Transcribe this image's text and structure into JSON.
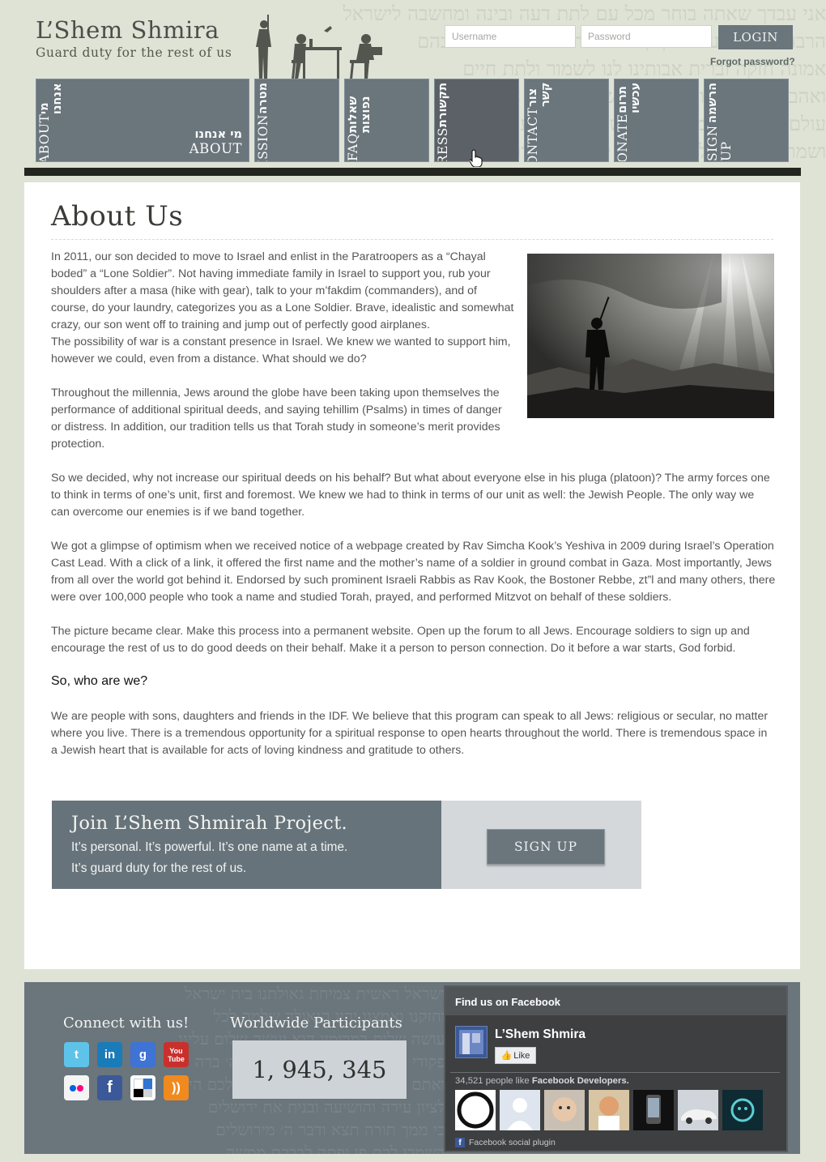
{
  "site": {
    "title": "L’Shem Shmira",
    "tagline": "Guard duty for the rest of us"
  },
  "login": {
    "username_placeholder": "Username",
    "password_placeholder": "Password",
    "login_label": "LOGIN",
    "forgot_label": "Forgot password?"
  },
  "nav": {
    "about": {
      "heb": "מי אנחנו",
      "eng": "ABOUT"
    },
    "items": [
      {
        "heb": "מטרה",
        "eng": "MISSION"
      },
      {
        "heb": "שאלות נפוצות",
        "eng": "FAQ"
      },
      {
        "heb": "תקשורת",
        "eng": "PRESS"
      },
      {
        "heb": "צור קשר",
        "eng": "CONTACT"
      },
      {
        "heb": "תרום עכשיו",
        "eng": "DONATE"
      },
      {
        "heb": "הרשמה",
        "eng": "SIGN UP"
      }
    ]
  },
  "page": {
    "title": "About Us",
    "p1": "In 2011, our son decided to move to Israel and enlist in the Paratroopers as a “Chayal boded” a “Lone Soldier”. Not having immediate family in Israel to support you, rub your shoulders after a masa (hike with gear), talk to your m’fakdim (commanders), and of course, do your laundry, categorizes you as a Lone Soldier. Brave, idealistic and somewhat crazy, our son went off to training and jump out of perfectly good airplanes.",
    "p2": "The possibility of war is a constant presence in Israel. We knew we wanted to support him, however we could, even from a distance. What should we do?",
    "p3": "Throughout the millennia, Jews around the globe have been taking upon themselves the performance of additional spiritual deeds, and saying tehillim (Psalms) in times of danger or distress. In addition, our tradition tells us that Torah study in someone’s merit provides protection.",
    "p4": "So we decided, why not increase our spiritual deeds on his behalf? But what about everyone else in his pluga (platoon)? The army forces one to think in terms of one’s unit, first and foremost. We knew we had to think in terms of our unit as well: the Jewish People. The only way we can overcome our enemies is if we band together.",
    "p5": "We got a glimpse of optimism when we received notice of a webpage created by Rav Simcha Kook’s Yeshiva in 2009 during Israel’s Operation Cast Lead. With a click of a link, it offered the first name and the mother’s name of a soldier in ground combat in Gaza. Most importantly, Jews from all over the world got behind it. Endorsed by such prominent Israeli Rabbis as Rav Kook, the Bostoner Rebbe, zt”l and many others, there were over 100,000 people who took a name and studied Torah, prayed, and performed Mitzvot on behalf of these soldiers.",
    "p6": "The picture became clear. Make this process into a permanent website. Open up the forum to all Jews. Encourage soldiers to sign up and encourage the rest of us to do good deeds on their behalf. Make it a person to person connection. Do it before a war starts, God forbid.",
    "subhead": "So, who are we?",
    "p7": "We are people with sons, daughters and friends in the IDF. We believe that this program can speak to all Jews: religious or secular, no matter where you live.  There is a tremendous opportunity for a spiritual response to open hearts throughout the world. There is tremendous space in a Jewish heart that is available for acts of loving kindness and gratitude to others."
  },
  "cta": {
    "title": "Join L’Shem Shmirah Project.",
    "line1": "It’s personal. It’s powerful. It’s one name at a time.",
    "line2": "It’s guard duty for the rest of us.",
    "button": "SIGN UP"
  },
  "footer": {
    "connect_title": "Connect with us!",
    "social_icons": [
      "twitter-icon",
      "linkedin-icon",
      "google-icon",
      "youtube-icon",
      "flickr-icon",
      "facebook-icon",
      "delicious-icon",
      "rss-icon"
    ],
    "participants_title": "Worldwide Participants",
    "participants_count": "1, 945, 345"
  },
  "facebook": {
    "header": "Find us on Facebook",
    "page_name": "L’Shem Shmira",
    "like_label": "Like",
    "count_prefix": "34,521 people like",
    "count_page": "Facebook Developers.",
    "plugin_label": "Facebook social plugin"
  }
}
